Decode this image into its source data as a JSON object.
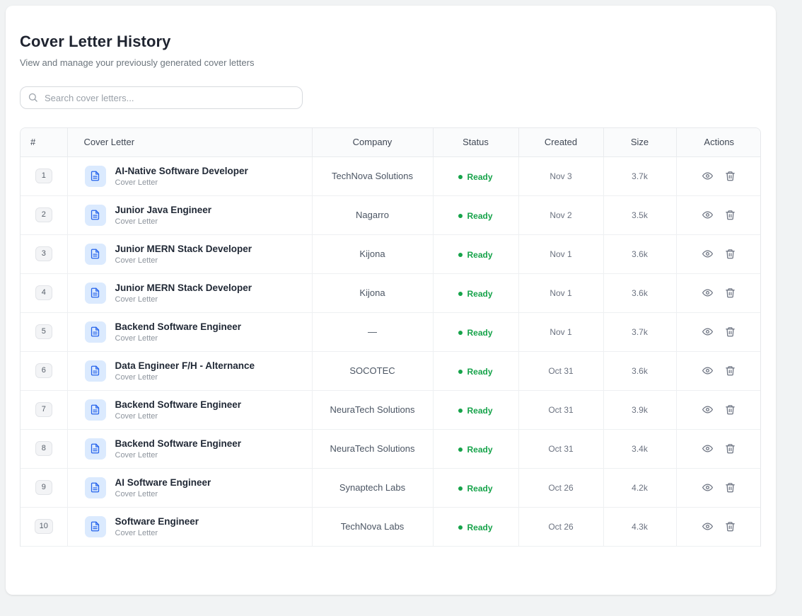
{
  "page": {
    "title": "Cover Letter History",
    "subtitle": "View and manage your previously generated cover letters"
  },
  "search": {
    "placeholder": "Search cover letters..."
  },
  "table": {
    "headers": {
      "index": "#",
      "cover_letter": "Cover Letter",
      "company": "Company",
      "status": "Status",
      "created": "Created",
      "size": "Size",
      "actions": "Actions"
    },
    "rows": [
      {
        "index": "1",
        "title": "AI-Native Software Developer",
        "type": "Cover Letter",
        "company": "TechNova Solutions",
        "status": "Ready",
        "created": "Nov 3",
        "size": "3.7k"
      },
      {
        "index": "2",
        "title": "Junior Java Engineer",
        "type": "Cover Letter",
        "company": "Nagarro",
        "status": "Ready",
        "created": "Nov 2",
        "size": "3.5k"
      },
      {
        "index": "3",
        "title": "Junior MERN Stack Developer",
        "type": "Cover Letter",
        "company": "Kijona",
        "status": "Ready",
        "created": "Nov 1",
        "size": "3.6k"
      },
      {
        "index": "4",
        "title": "Junior MERN Stack Developer",
        "type": "Cover Letter",
        "company": "Kijona",
        "status": "Ready",
        "created": "Nov 1",
        "size": "3.6k"
      },
      {
        "index": "5",
        "title": "Backend Software Engineer",
        "type": "Cover Letter",
        "company": "—",
        "status": "Ready",
        "created": "Nov 1",
        "size": "3.7k"
      },
      {
        "index": "6",
        "title": "Data Engineer F/H - Alternance",
        "type": "Cover Letter",
        "company": "SOCOTEC",
        "status": "Ready",
        "created": "Oct 31",
        "size": "3.6k"
      },
      {
        "index": "7",
        "title": "Backend Software Engineer",
        "type": "Cover Letter",
        "company": "NeuraTech Solutions",
        "status": "Ready",
        "created": "Oct 31",
        "size": "3.9k"
      },
      {
        "index": "8",
        "title": "Backend Software Engineer",
        "type": "Cover Letter",
        "company": "NeuraTech Solutions",
        "status": "Ready",
        "created": "Oct 31",
        "size": "3.4k"
      },
      {
        "index": "9",
        "title": "AI Software Engineer",
        "type": "Cover Letter",
        "company": "Synaptech Labs",
        "status": "Ready",
        "created": "Oct 26",
        "size": "4.2k"
      },
      {
        "index": "10",
        "title": "Software Engineer",
        "type": "Cover Letter",
        "company": "TechNova Labs",
        "status": "Ready",
        "created": "Oct 26",
        "size": "4.3k"
      }
    ]
  },
  "icons": {
    "search": "search-icon",
    "document": "file-text-icon",
    "view": "eye-icon",
    "delete": "trash-icon",
    "status": "dot-icon"
  },
  "colors": {
    "accent_blue": "#2563eb",
    "status_green": "#16a34a"
  }
}
